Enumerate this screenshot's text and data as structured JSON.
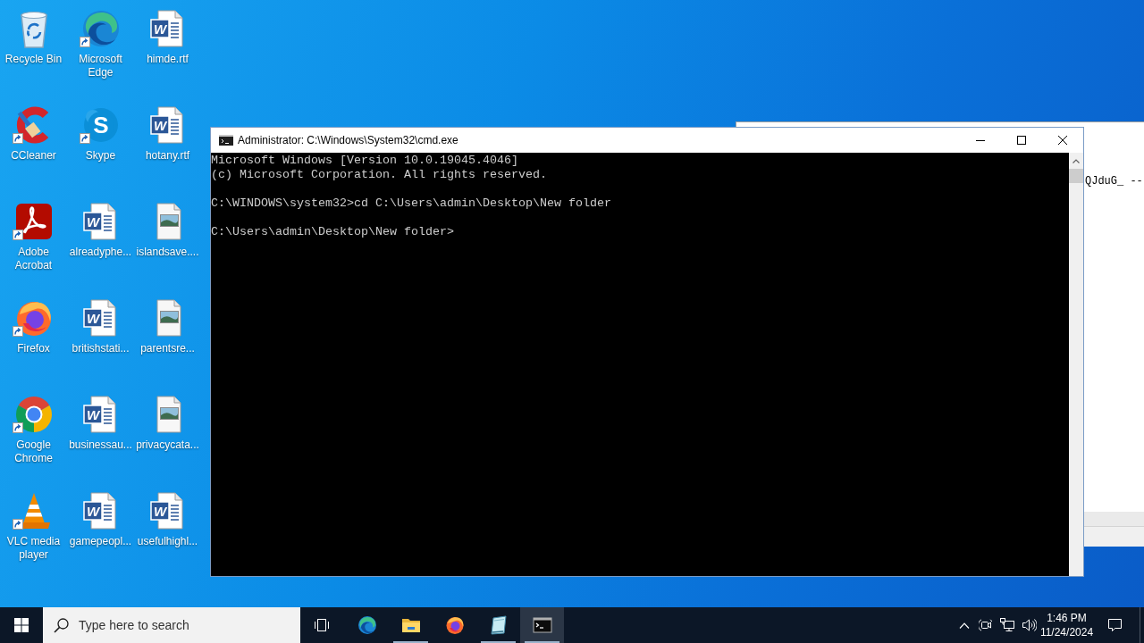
{
  "desktop_icons": [
    {
      "label": "Recycle Bin",
      "kind": "recycle-bin",
      "shortcut": false
    },
    {
      "label": "CCleaner",
      "kind": "ccleaner",
      "shortcut": true
    },
    {
      "label": "Adobe Acrobat",
      "kind": "acrobat",
      "shortcut": true
    },
    {
      "label": "Firefox",
      "kind": "firefox",
      "shortcut": true
    },
    {
      "label": "Google Chrome",
      "kind": "chrome",
      "shortcut": true
    },
    {
      "label": "VLC media player",
      "kind": "vlc",
      "shortcut": true
    },
    {
      "label": "Microsoft Edge",
      "kind": "edge",
      "shortcut": true
    },
    {
      "label": "Skype",
      "kind": "skype",
      "shortcut": true,
      "glyph": "S"
    },
    {
      "label": "alreadyphe...",
      "kind": "word-doc",
      "shortcut": false,
      "glyph": "W"
    },
    {
      "label": "britishstati...",
      "kind": "word-doc",
      "shortcut": false,
      "glyph": "W"
    },
    {
      "label": "businessau...",
      "kind": "word-doc",
      "shortcut": false,
      "glyph": "W"
    },
    {
      "label": "gamepeopl...",
      "kind": "word-doc",
      "shortcut": false,
      "glyph": "W"
    },
    {
      "label": "himde.rtf",
      "kind": "word-doc",
      "shortcut": false,
      "glyph": "W"
    },
    {
      "label": "hotany.rtf",
      "kind": "word-doc",
      "shortcut": false,
      "glyph": "W"
    },
    {
      "label": "islandsave....",
      "kind": "image-file",
      "shortcut": false
    },
    {
      "label": "parentsre...",
      "kind": "image-file",
      "shortcut": false
    },
    {
      "label": "privacycata...",
      "kind": "image-file",
      "shortcut": false
    },
    {
      "label": "usefulhighl...",
      "kind": "word-doc",
      "shortcut": false,
      "glyph": "W"
    }
  ],
  "background_window": {
    "text": "QJduG_ --"
  },
  "console_window": {
    "title": "Administrator: C:\\Windows\\System32\\cmd.exe",
    "blocks": [
      [
        "Microsoft Windows [Version 10.0.19045.4046]",
        "(c) Microsoft Corporation. All rights reserved."
      ],
      [
        "C:\\WINDOWS\\system32>cd C:\\Users\\admin\\Desktop\\New folder"
      ],
      [
        "C:\\Users\\admin\\Desktop\\New folder>"
      ]
    ]
  },
  "taskbar": {
    "search": {
      "placeholder": "Type here to search"
    },
    "apps": [
      {
        "kind": "edge",
        "running": false,
        "selected": false
      },
      {
        "kind": "file-explorer",
        "running": true,
        "selected": false
      },
      {
        "kind": "firefox",
        "running": false,
        "selected": false
      },
      {
        "kind": "sheet",
        "running": true,
        "selected": false
      },
      {
        "kind": "command-prompt",
        "running": true,
        "selected": true
      }
    ],
    "clock": {
      "time": "1:46 PM",
      "date": "11/24/2024"
    }
  }
}
